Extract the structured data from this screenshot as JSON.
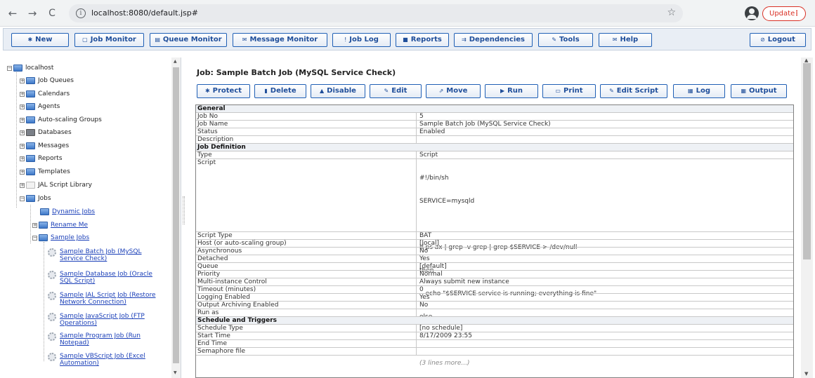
{
  "browser": {
    "back_glyph": "←",
    "forward_glyph": "→",
    "reload_glyph": "C",
    "info_glyph": "i",
    "url": "localhost:8080/default.jsp#",
    "star_glyph": "☆",
    "update_label": "Update",
    "menu_glyph": "⋮"
  },
  "toolbar": {
    "buttons": [
      {
        "icon": "✱",
        "label": "New"
      },
      {
        "icon": "▢",
        "label": "Job Monitor"
      },
      {
        "icon": "▤",
        "label": "Queue Monitor"
      },
      {
        "icon": "✉",
        "label": "Message Monitor"
      },
      {
        "icon": "!",
        "label": "Job Log"
      },
      {
        "icon": "■",
        "label": "Reports"
      },
      {
        "icon": "⇉",
        "label": "Dependencies"
      },
      {
        "icon": "✎",
        "label": "Tools"
      },
      {
        "icon": "✉",
        "label": "Help"
      }
    ],
    "logout": {
      "icon": "⊘",
      "label": "Logout"
    }
  },
  "tree": {
    "root": "localhost",
    "top_items": [
      "Job Queues",
      "Calendars",
      "Agents",
      "Auto-scaling Groups",
      "Databases",
      "Messages",
      "Reports",
      "Templates",
      "JAL Script Library",
      "Jobs"
    ],
    "jobs_children": [
      "Dynamic Jobs",
      "Rename Me",
      "Sample Jobs"
    ],
    "sample_jobs": [
      [
        "Sample Batch Job (MySQL",
        "Service Check)"
      ],
      [
        "Sample Database Job (Oracle",
        "SQL Script)"
      ],
      [
        "Sample JAL Script Job (Restore",
        "Network Connection)"
      ],
      [
        "Sample JavaScript Job (FTP",
        "Operations)"
      ],
      [
        "Sample Program Job (Run",
        "Notepad)"
      ],
      [
        "Sample VBScript Job (Excel",
        "Automation)"
      ]
    ]
  },
  "main": {
    "title": "Job: Sample Batch Job (MySQL Service Check)",
    "actions": [
      {
        "icon": "✱",
        "label": "Protect"
      },
      {
        "icon": "▮",
        "label": "Delete"
      },
      {
        "icon": "▲",
        "label": "Disable"
      },
      {
        "icon": "✎",
        "label": "Edit"
      },
      {
        "icon": "⇗",
        "label": "Move"
      },
      {
        "icon": "▶",
        "label": "Run"
      },
      {
        "icon": "▭",
        "label": "Print"
      },
      {
        "icon": "✎",
        "label": "Edit Script"
      },
      {
        "icon": "▦",
        "label": "Log"
      },
      {
        "icon": "▦",
        "label": "Output"
      }
    ],
    "sections": {
      "general": "General",
      "job_definition": "Job Definition",
      "schedule": "Schedule and Triggers"
    },
    "general_rows": [
      {
        "k": "Job No",
        "v": "5"
      },
      {
        "k": "Job Name",
        "v": "Sample Batch Job (MySQL Service Check)"
      },
      {
        "k": "Status",
        "v": "Enabled"
      },
      {
        "k": "Description",
        "v": ""
      }
    ],
    "definition_rows": [
      {
        "k": "Type",
        "v": "Script"
      }
    ],
    "script_key": "Script",
    "script_lines": [
      "#!/bin/sh",
      "SERVICE=mysqld",
      "",
      "if ps ax | grep -v grep | grep $SERVICE > /dev/null",
      "then",
      "   echo \"$SERVICE service is running; everything is fine\"",
      "else",
      ""
    ],
    "script_more": "(3 lines more...)",
    "definition_rows_2": [
      {
        "k": "Script Type",
        "v": "BAT"
      },
      {
        "k": "Host (or auto-scaling group)",
        "v": "[local]"
      },
      {
        "k": "Asynchronous",
        "v": "No"
      },
      {
        "k": "Detached",
        "v": "Yes"
      },
      {
        "k": "Queue",
        "v": "[default]"
      },
      {
        "k": "Priority",
        "v": "Normal"
      },
      {
        "k": "Multi-instance Control",
        "v": "Always submit new instance"
      },
      {
        "k": "Timeout (minutes)",
        "v": "0"
      },
      {
        "k": "Logging Enabled",
        "v": "Yes"
      },
      {
        "k": "Output Archiving Enabled",
        "v": "No"
      },
      {
        "k": "Run as",
        "v": ""
      }
    ],
    "schedule_rows": [
      {
        "k": "Schedule Type",
        "v": "[no schedule]"
      },
      {
        "k": "Start Time",
        "v": "8/17/2009 23:55"
      },
      {
        "k": "End Time",
        "v": ""
      },
      {
        "k": "Semaphore file",
        "v": ""
      }
    ]
  }
}
